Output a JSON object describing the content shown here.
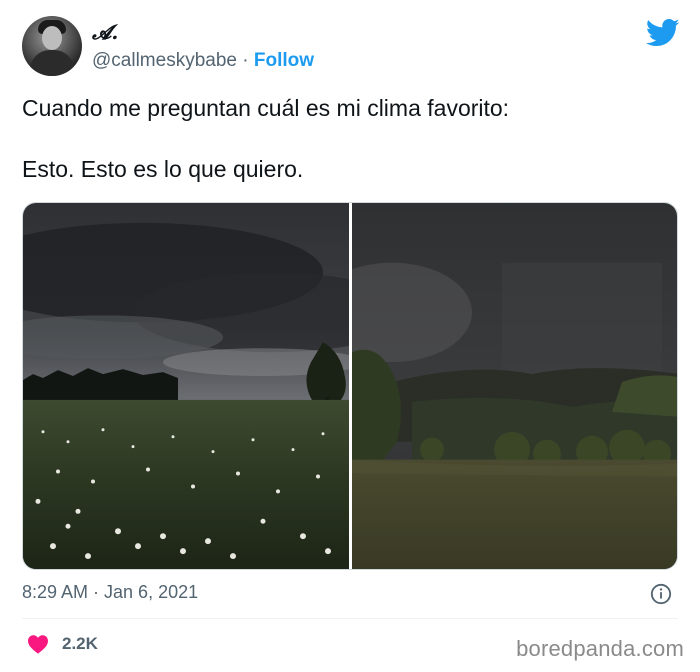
{
  "tweet": {
    "display_name": "𝓐.",
    "handle": "@callmeskybabe",
    "separator": "·",
    "follow_label": "Follow",
    "text_line_1": "Cuando me preguntan cuál es mi clima favorito:",
    "text_line_2": "Esto. Esto es lo que quiero.",
    "timestamp": "8:29 AM · Jan 6, 2021",
    "like_count": "2.2K"
  },
  "icons": {
    "brand": "twitter-bird-icon",
    "info": "info-icon",
    "like": "heart-icon"
  },
  "colors": {
    "accent": "#1d9bf0",
    "like": "#f91880",
    "secondary_text": "#536471"
  },
  "watermark": "boredpanda.com"
}
